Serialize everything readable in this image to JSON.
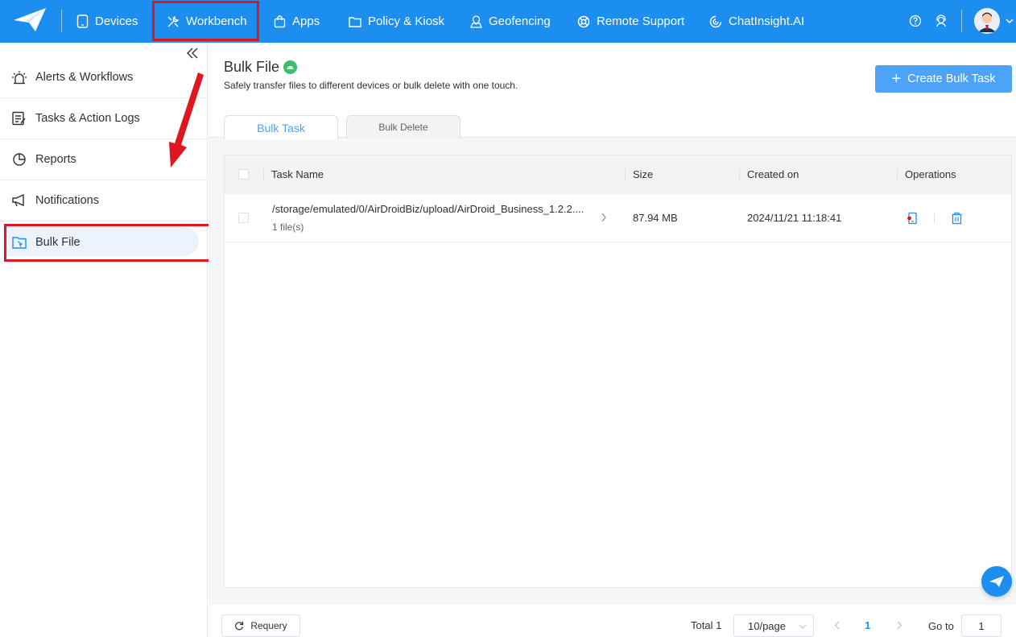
{
  "topbar": {
    "nav": [
      {
        "label": "Devices",
        "icon": "tablet-icon"
      },
      {
        "label": "Workbench",
        "icon": "tools-icon"
      },
      {
        "label": "Apps",
        "icon": "shopping-bag-icon"
      },
      {
        "label": "Policy & Kiosk",
        "icon": "folder-icon"
      },
      {
        "label": "Geofencing",
        "icon": "map-pin-icon"
      },
      {
        "label": "Remote Support",
        "icon": "lifebuoy-icon"
      },
      {
        "label": "ChatInsight.AI",
        "icon": "ai-chat-icon"
      }
    ],
    "highlighted": "Workbench",
    "accent": "#1c8ef0"
  },
  "sidebar": {
    "items": [
      {
        "label": "Alerts & Workflows",
        "icon": "alarm-icon"
      },
      {
        "label": "Tasks & Action Logs",
        "icon": "task-list-icon"
      },
      {
        "label": "Reports",
        "icon": "pie-chart-icon"
      },
      {
        "label": "Notifications",
        "icon": "megaphone-icon"
      },
      {
        "label": "Bulk File",
        "icon": "file-folder-icon"
      }
    ],
    "active": "Bulk File"
  },
  "page": {
    "title": "Bulk File",
    "subtitle": "Safely transfer files to different devices or bulk delete with one touch.",
    "create_button": "Create Bulk Task"
  },
  "tabs": [
    {
      "label": "Bulk Task",
      "active": true
    },
    {
      "label": "Bulk Delete",
      "active": false
    }
  ],
  "table": {
    "columns": [
      "Task Name",
      "Size",
      "Created on",
      "Operations"
    ],
    "rows": [
      {
        "task_name": "/storage/emulated/0/AirDroidBiz/upload/AirDroid_Business_1.2.2....",
        "files": "1 file(s)",
        "size": "87.94 MB",
        "created_on": "2024/11/21 11:18:41"
      }
    ]
  },
  "footer": {
    "requery": "Requery",
    "total": "Total 1",
    "page_size": "10/page",
    "current_page": "1",
    "goto_label": "Go to",
    "goto_value": "1"
  },
  "colors": {
    "highlight_box": "#e0161e",
    "primary_button": "#4da3f6",
    "android_badge": "#3ebd6b"
  }
}
